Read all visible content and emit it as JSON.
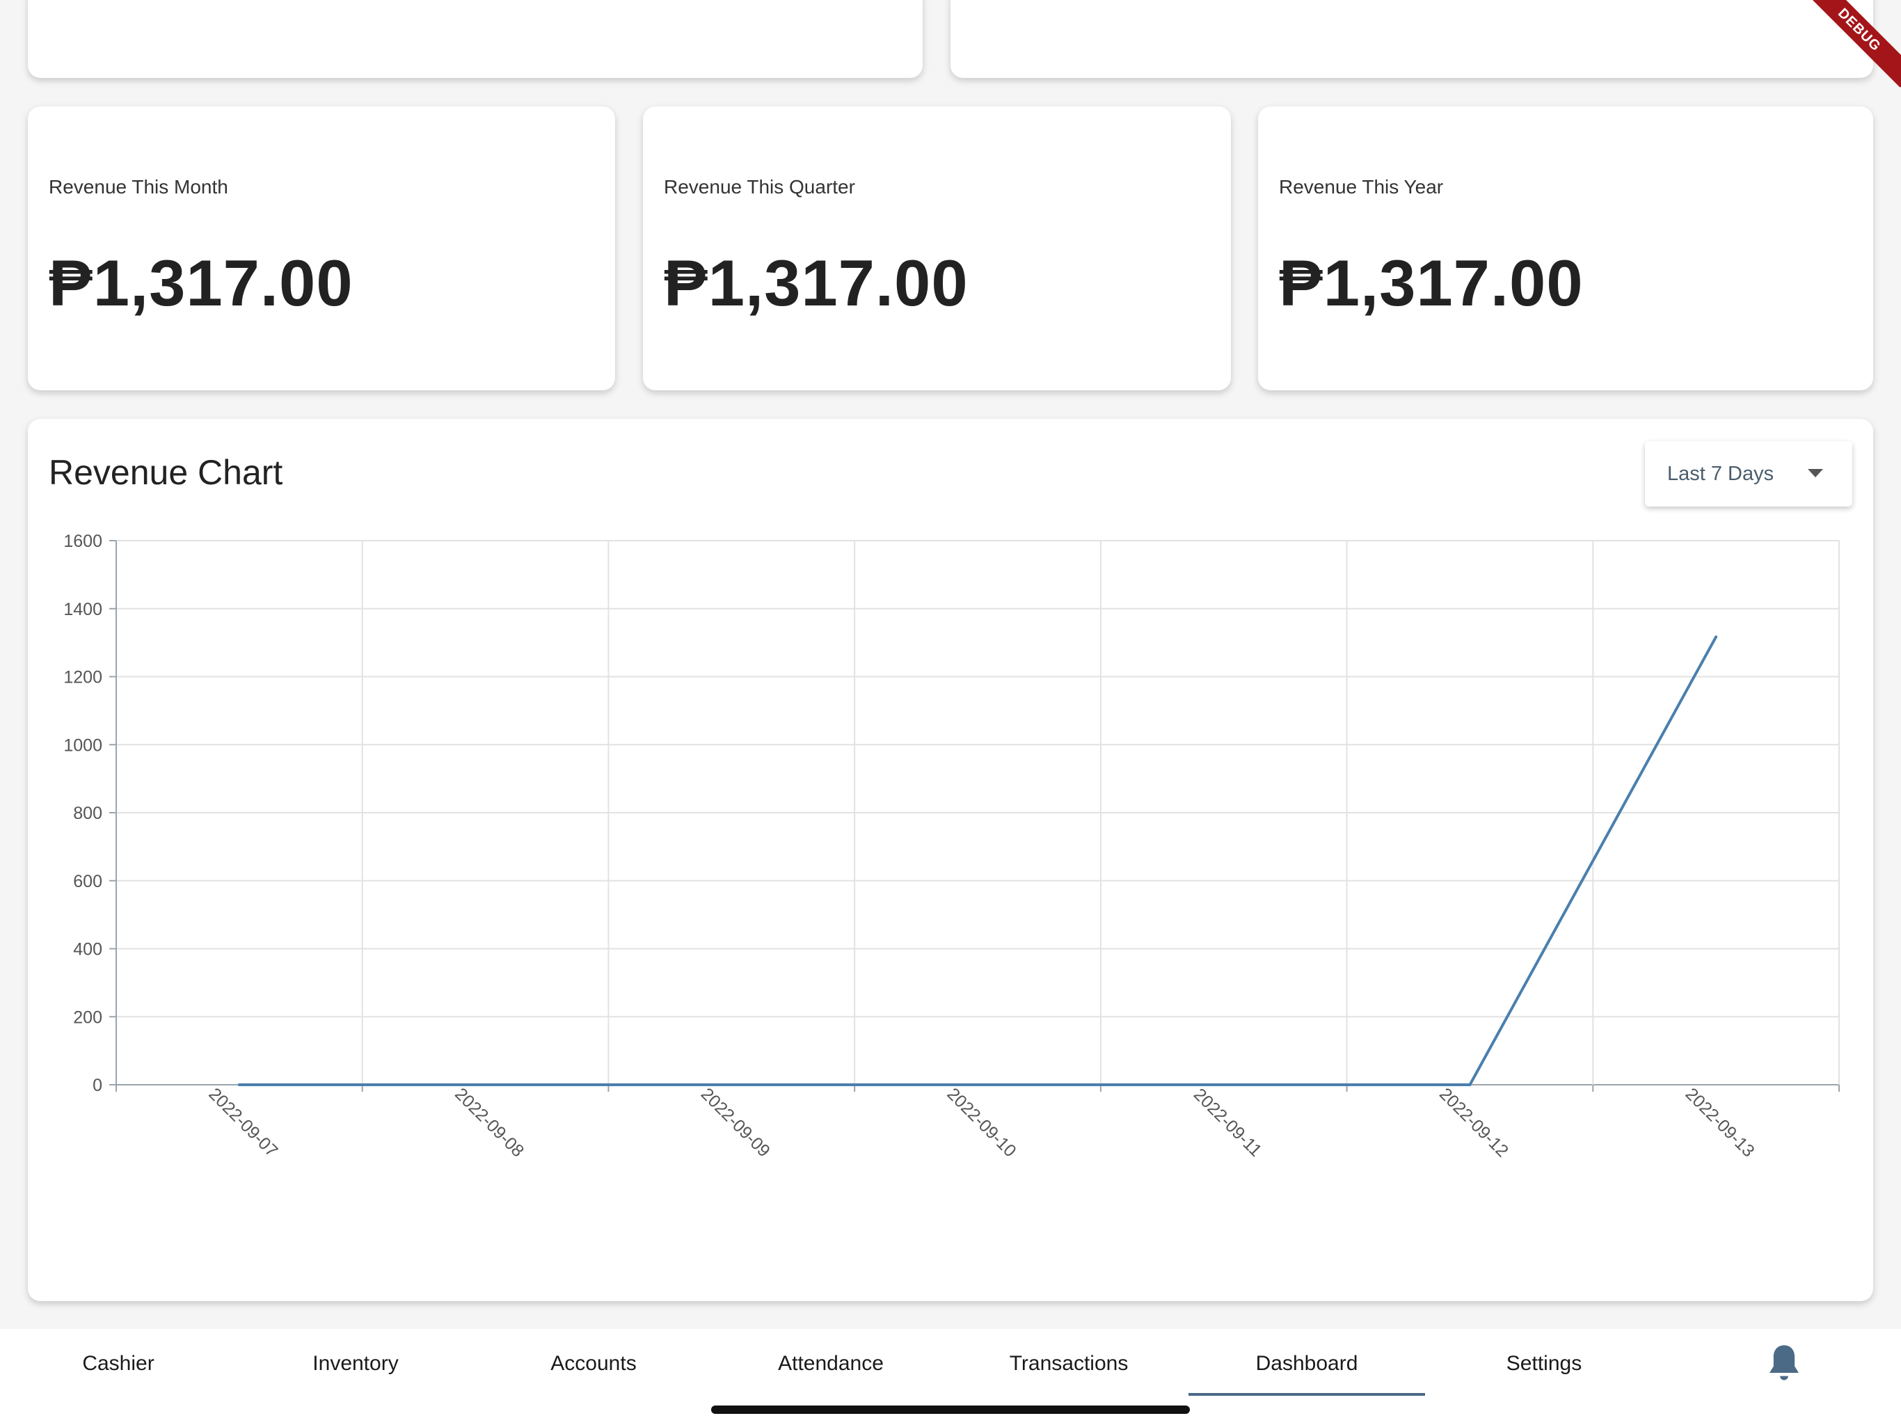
{
  "stats": {
    "month": {
      "label": "Revenue This Month",
      "value": "₱1,317.00"
    },
    "quarter": {
      "label": "Revenue This Quarter",
      "value": "₱1,317.00"
    },
    "year": {
      "label": "Revenue This Year",
      "value": "₱1,317.00"
    }
  },
  "chart_card": {
    "title": "Revenue Chart",
    "range_dropdown": {
      "selected": "Last 7 Days"
    }
  },
  "chart_data": {
    "type": "line",
    "title": "Revenue Chart",
    "x": [
      "2022-09-07",
      "2022-09-08",
      "2022-09-09",
      "2022-09-10",
      "2022-09-11",
      "2022-09-12",
      "2022-09-13"
    ],
    "series": [
      {
        "values": [
          0,
          0,
          0,
          0,
          0,
          0,
          1317
        ]
      }
    ],
    "y_ticks": [
      "0",
      "200",
      "400",
      "600",
      "800",
      "1000",
      "1200",
      "1400",
      "1600"
    ],
    "ylim": [
      0,
      1600
    ],
    "grid": true,
    "line_color": "#4a7fae"
  },
  "nav": {
    "items": [
      "Cashier",
      "Inventory",
      "Accounts",
      "Attendance",
      "Transactions",
      "Dashboard",
      "Settings"
    ],
    "active": "Dashboard",
    "notification_icon": "bell-icon"
  },
  "debug_banner": "DEBUG",
  "colors": {
    "accent": "#4b6a86",
    "background": "#f5f5f5",
    "card": "#ffffff",
    "debug": "#a4151a"
  }
}
